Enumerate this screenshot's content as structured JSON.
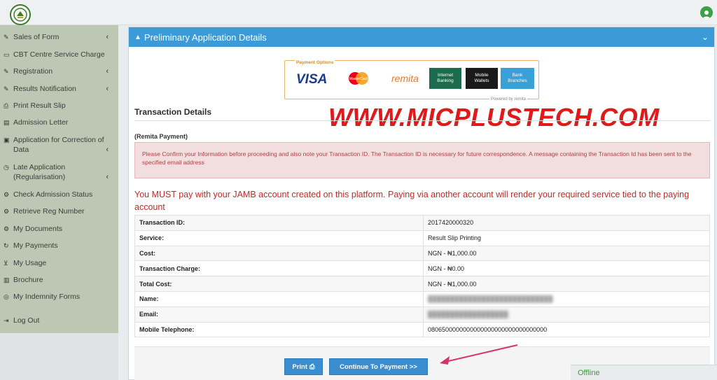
{
  "sidebar": {
    "items": [
      {
        "label": "Sales of Form",
        "icon": "edit-icon",
        "chevron": "‹"
      },
      {
        "label": "CBT Centre Service Charge",
        "icon": "card-icon"
      },
      {
        "label": "Registration",
        "icon": "edit-icon",
        "chevron": "‹"
      },
      {
        "label": "Results Notification",
        "icon": "edit-icon",
        "chevron": "‹"
      },
      {
        "label": "Print Result Slip",
        "icon": "printer-icon"
      },
      {
        "label": "Admission Letter",
        "icon": "document-icon"
      },
      {
        "label": "Application for Correction of Data",
        "icon": "form-icon",
        "chevron": "‹"
      },
      {
        "label": "Late Application (Regularisation)",
        "icon": "clock-icon",
        "chevron": "‹"
      },
      {
        "label": "Check Admission Status",
        "icon": "gear-icon"
      },
      {
        "label": "Retrieve Reg Number",
        "icon": "gear-icon"
      },
      {
        "label": "My Documents",
        "icon": "gear-icon"
      },
      {
        "label": "My Payments",
        "icon": "refresh-icon"
      },
      {
        "label": "My Usage",
        "icon": "cart-icon"
      },
      {
        "label": "Brochure",
        "icon": "book-icon"
      },
      {
        "label": "My Indemnity Forms",
        "icon": "target-icon"
      },
      {
        "label": "Log Out",
        "icon": "logout-icon"
      }
    ]
  },
  "panel": {
    "title": "Preliminary Application Details",
    "title_icon": "warning-icon",
    "caret": "⌄"
  },
  "payment_options": {
    "title": "Payment Options",
    "visa": "VISA",
    "mastercard": "MasterCard",
    "remita": "remita",
    "internet_banking": "Internet Banking",
    "mobile_wallets": "Mobile Wallets",
    "bank_branches": "Bank Branches",
    "powered_by": "Powered by remita"
  },
  "watermark": "WWW.MICPLUSTECH.COM",
  "section_title": "Transaction Details",
  "remita_label": "(Remita Payment)",
  "alert_text": "Please Confirm your Information before proceeding and also note your Transaction ID. The Transaction ID is necessary for future correspondence. A message containing the Transaction Id has been sent to the specified email address",
  "must_pay_text": "You MUST pay with your JAMB account created on this platform. Paying via another account will render your required service tied to the paying account",
  "transaction": {
    "rows": [
      {
        "label": "Transaction ID:",
        "value": "2017420000320"
      },
      {
        "label": "Service:",
        "value": "Result Slip Printing"
      },
      {
        "label": "Cost:",
        "value": "NGN - ₦1,000.00"
      },
      {
        "label": "Transaction Charge:",
        "value": "NGN - ₦0.00"
      },
      {
        "label": "Total Cost:",
        "value": "NGN - ₦1,000.00"
      },
      {
        "label": "Name:",
        "value": "████████████████████████████"
      },
      {
        "label": "Email:",
        "value": "██████████████████"
      },
      {
        "label": "Mobile Telephone:",
        "value": "0806500000000000000000000000000000"
      }
    ]
  },
  "buttons": {
    "print": "Print",
    "continue": "Continue To Payment >>"
  },
  "status": {
    "offline": "Offline"
  },
  "colors": {
    "panel_header": "#3c9ad6",
    "sidebar": "#bcc7b4",
    "button": "#3a8ed0",
    "alert_bg": "#f2dede",
    "alert_text": "#a94442",
    "warning_text": "#c62828",
    "watermark": "#e01a1a"
  }
}
